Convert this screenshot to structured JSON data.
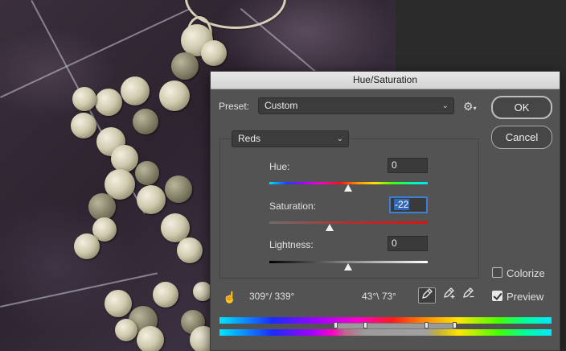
{
  "dialog": {
    "title": "Hue/Saturation",
    "preset_label": "Preset:",
    "preset_value": "Custom",
    "ok_label": "OK",
    "cancel_label": "Cancel",
    "channel_value": "Reds",
    "hue_label": "Hue:",
    "hue_value": "0",
    "saturation_label": "Saturation:",
    "saturation_value": "-22",
    "lightness_label": "Lightness:",
    "lightness_value": "0",
    "colorize_label": "Colorize",
    "colorize_checked": false,
    "preview_label": "Preview",
    "preview_checked": true,
    "range_left": "309°/ 339°",
    "range_right": "43°\\ 73°",
    "icons": {
      "preset_options": "gear-icon",
      "chevron": "chevron-down-icon",
      "target_adjust": "hand-icon",
      "eyedropper": "eyedropper-icon",
      "eyedropper_add": "eyedropper-plus-icon",
      "eyedropper_subtract": "eyedropper-minus-icon"
    }
  }
}
